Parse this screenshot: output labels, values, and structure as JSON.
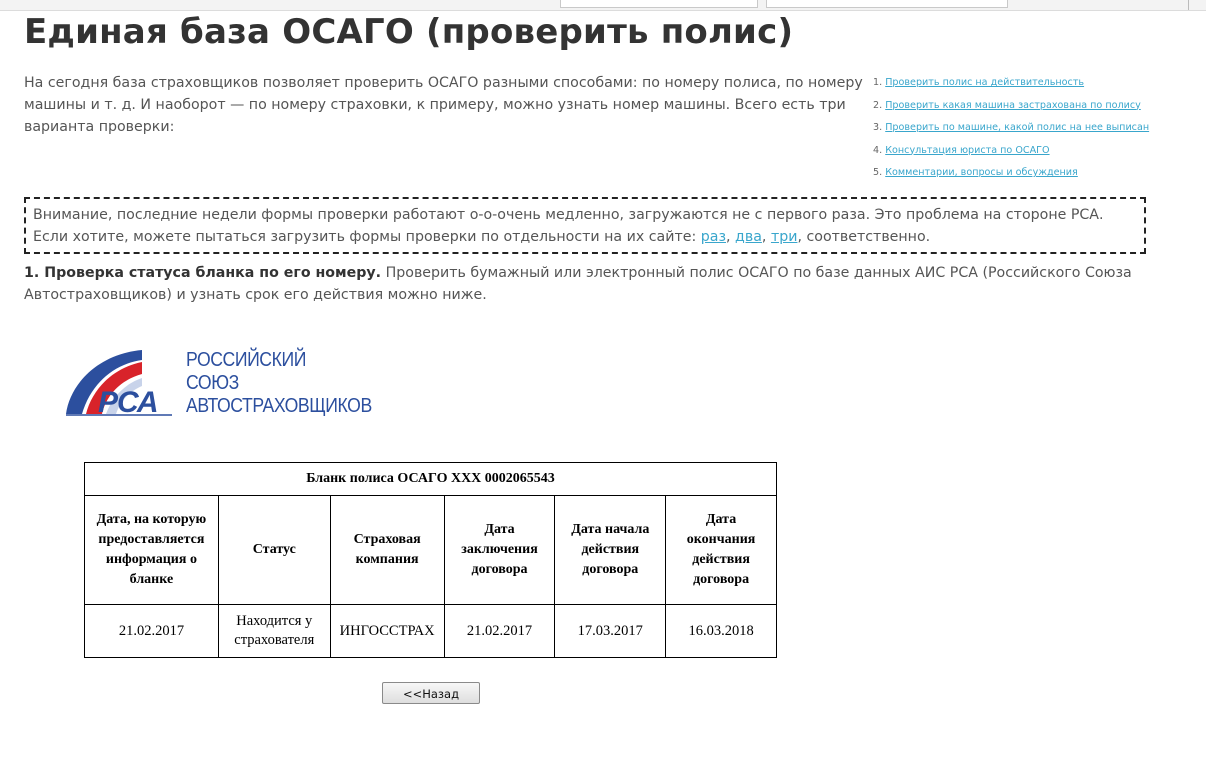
{
  "page": {
    "title": "Единая база ОСАГО (проверить полис)",
    "intro": "На сегодня база страховщиков позволяет проверить ОСАГО разными способами: по номеру полиса, по номеру машины и т. д. И наоборот — по номеру страховки, к примеру, можно узнать номер машины. Всего есть три варианта проверки:"
  },
  "toc": [
    {
      "num": "1.",
      "label": "Проверить полис на действительность"
    },
    {
      "num": "2.",
      "label": "Проверить какая машина застрахована по полису"
    },
    {
      "num": "3.",
      "label": "Проверить по машине, какой полис на нее выписан"
    },
    {
      "num": "4.",
      "label": "Консультация юриста по ОСАГО"
    },
    {
      "num": "5.",
      "label": "Комментарии, вопросы и обсуждения"
    }
  ],
  "notice": {
    "text": "Внимание, последние недели формы проверки работают о-о-очень медленно, загружаются не с первого раза. Это проблема на стороне РСА. Если хотите, можете пытаться загрузить формы проверки по отдельности на их сайте: ",
    "links": [
      "раз",
      "два",
      "три"
    ],
    "separator": ", ",
    "tail": ", соответственно."
  },
  "step1": {
    "bold": "1. Проверка статуса бланка по его номеру.",
    "text": " Проверить бумажный или электронный полис ОСАГО по базе данных АИС РСА (Российского Союза Автостраховщиков) и узнать срок его действия можно ниже."
  },
  "logo": {
    "abbr": "РСА",
    "lines": [
      "РОССИЙСКИЙ",
      "СОЮЗ",
      "АВТОСТРАХОВЩИКОВ"
    ],
    "colors": {
      "blue": "#2c4f9e",
      "red": "#d8232a"
    }
  },
  "table": {
    "caption": "Бланк полиса ОСАГО ХХХ 0002065543",
    "headers": [
      "Дата, на которую предоставляется информация о бланке",
      "Статус",
      "Страховая компания",
      "Дата заключения договора",
      "Дата начала действия договора",
      "Дата окончания действия договора"
    ],
    "row": [
      "21.02.2017",
      "Находится у страхователя",
      "ИНГОССТРАХ",
      "21.02.2017",
      "17.03.2017",
      "16.03.2018"
    ]
  },
  "back_button": "<<Назад"
}
